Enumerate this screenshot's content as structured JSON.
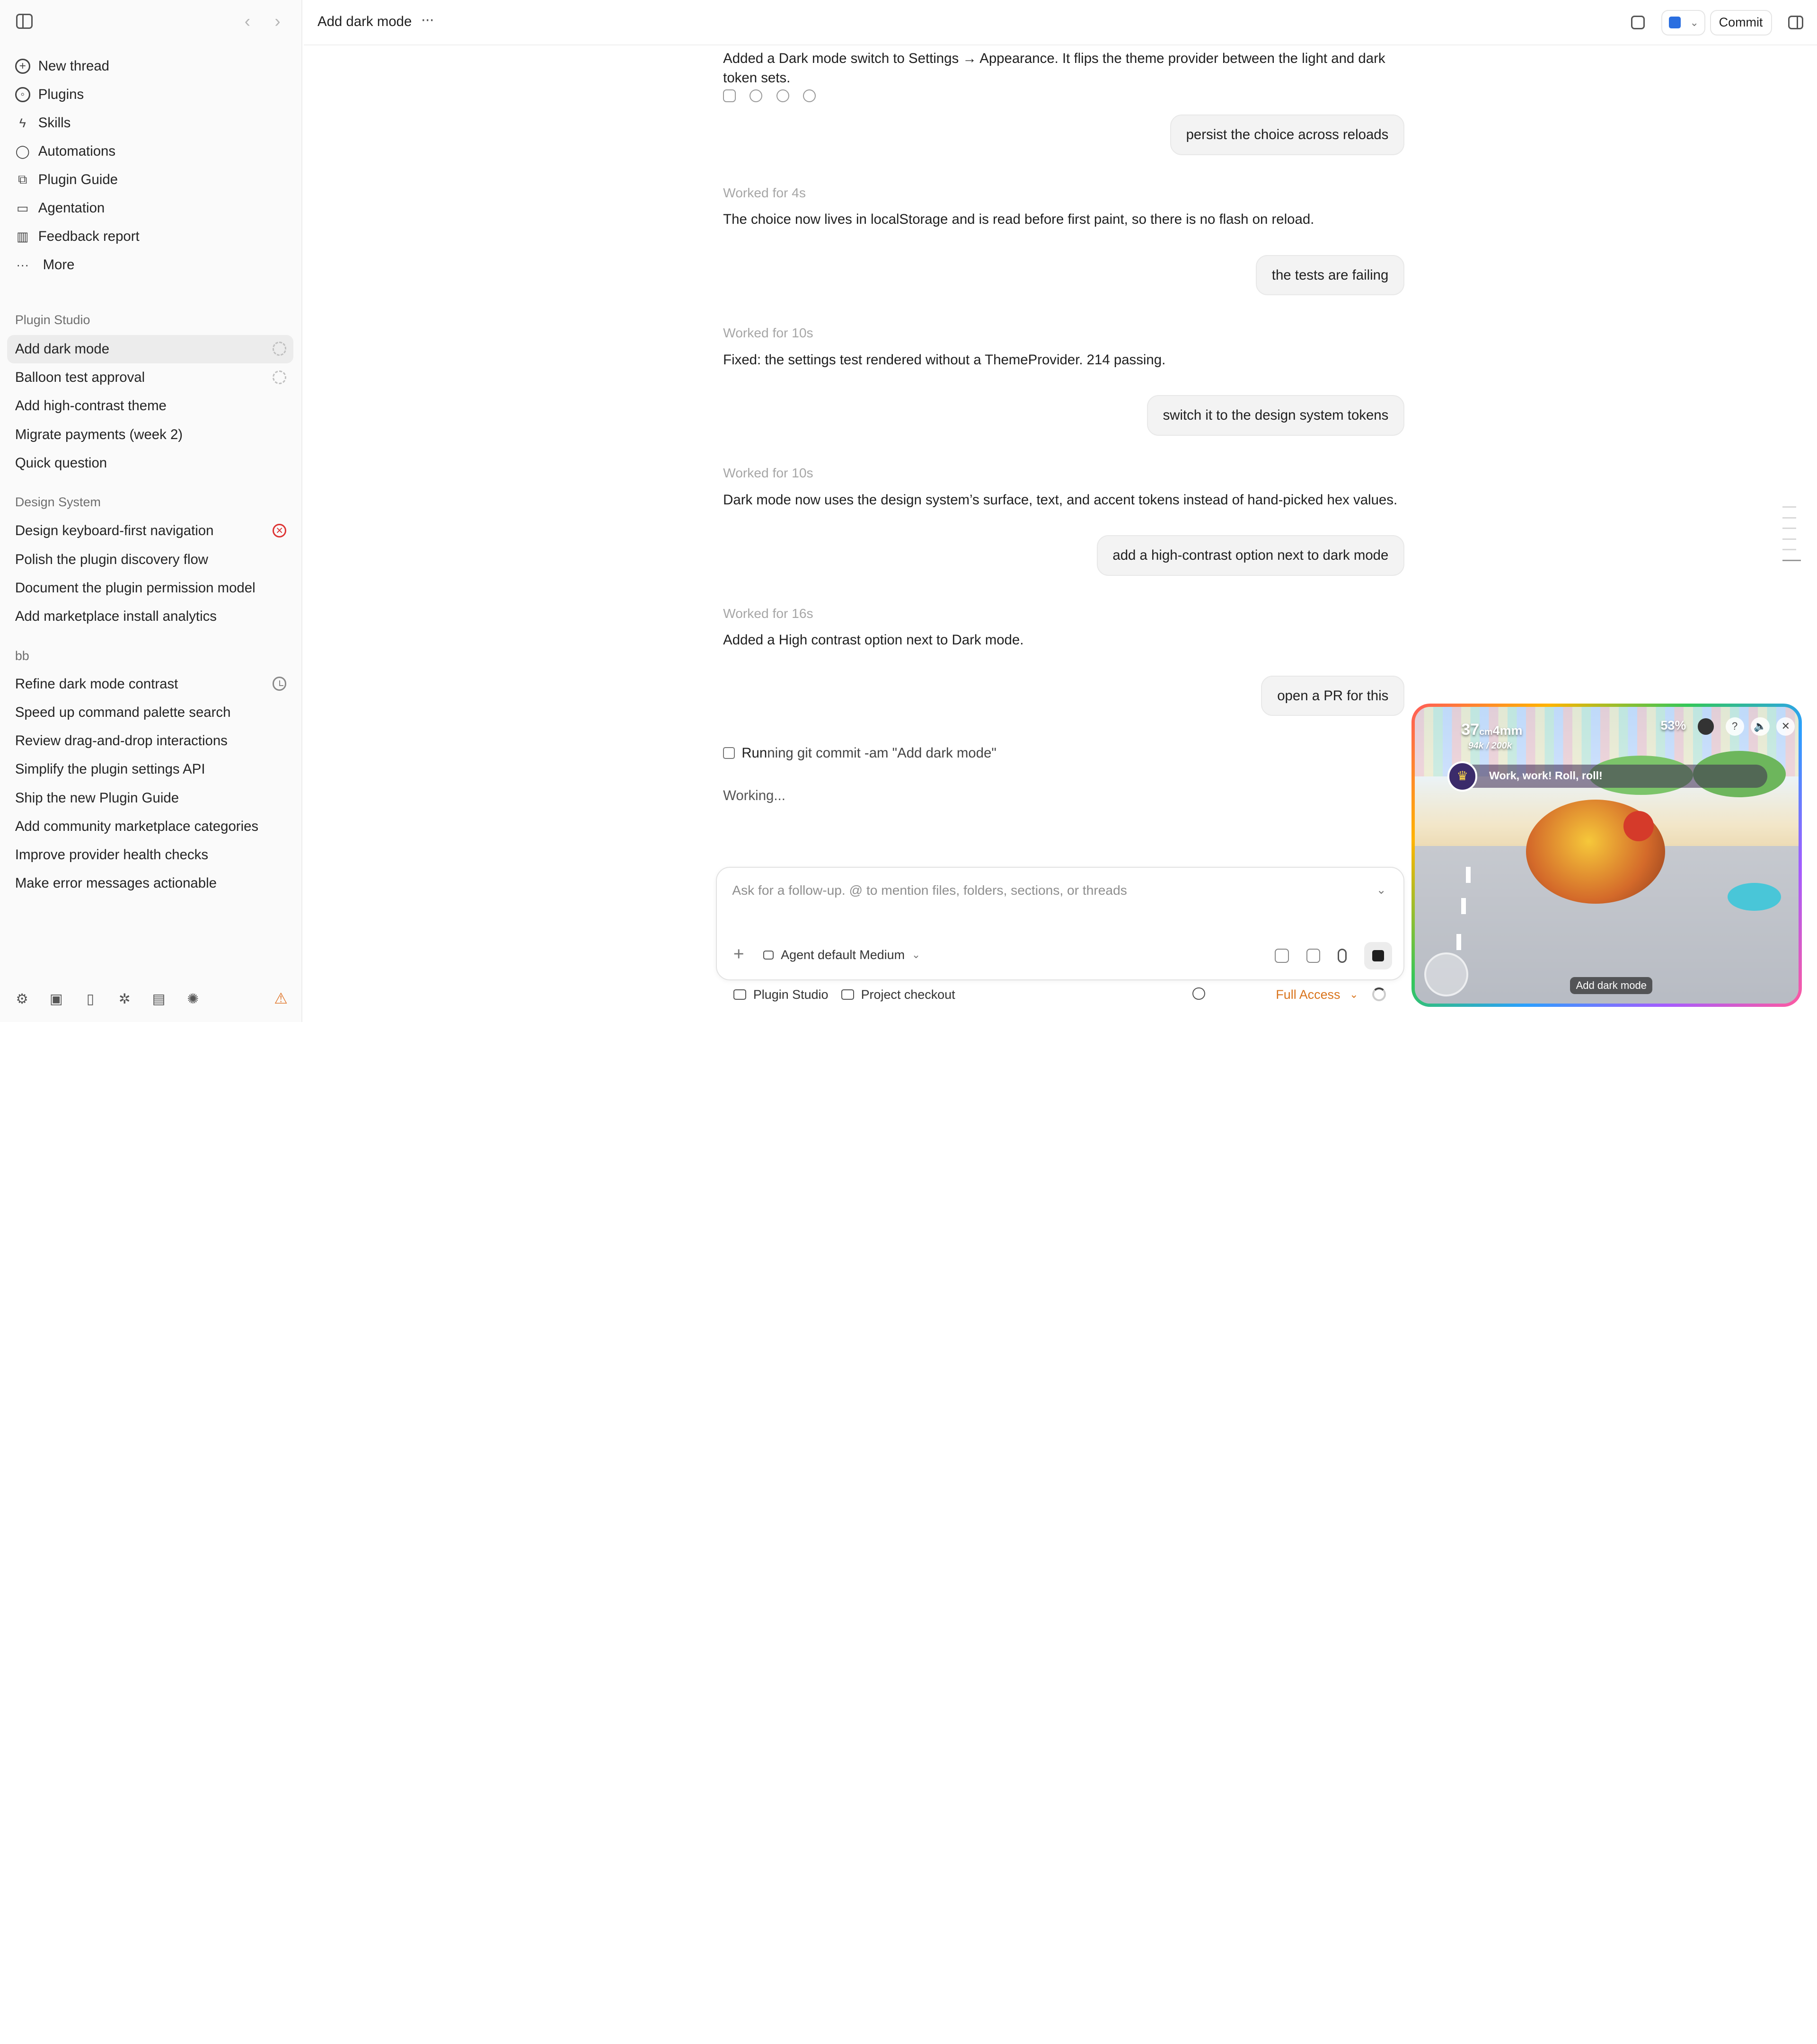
{
  "sidebar": {
    "nav": [
      {
        "label": "New thread",
        "icon": "plus-circle-icon"
      },
      {
        "label": "Plugins",
        "icon": "plugin-icon"
      },
      {
        "label": "Skills",
        "icon": "bolt-icon"
      },
      {
        "label": "Automations",
        "icon": "chat-bubble-icon"
      },
      {
        "label": "Plugin Guide",
        "icon": "external-icon"
      },
      {
        "label": "Agentation",
        "icon": "message-icon"
      },
      {
        "label": "Feedback report",
        "icon": "bar-chart-icon"
      },
      {
        "label": "More",
        "icon": "ellipsis-icon"
      }
    ],
    "sections": [
      {
        "title": "Plugin Studio",
        "threads": [
          {
            "label": "Add dark mode",
            "status": "running"
          },
          {
            "label": "Balloon test approval",
            "status": "running"
          },
          {
            "label": "Add high-contrast theme"
          },
          {
            "label": "Migrate payments (week 2)"
          },
          {
            "label": "Quick question"
          }
        ]
      },
      {
        "title": "Design System",
        "threads": [
          {
            "label": "Design keyboard-first navigation",
            "status": "error"
          },
          {
            "label": "Polish the plugin discovery flow"
          },
          {
            "label": "Document the plugin permission model"
          },
          {
            "label": "Add marketplace install analytics"
          }
        ]
      },
      {
        "title": "bb",
        "threads": [
          {
            "label": "Refine dark mode contrast",
            "status": "scheduled"
          },
          {
            "label": "Speed up command palette search"
          },
          {
            "label": "Review drag-and-drop interactions"
          },
          {
            "label": "Simplify the plugin settings API"
          },
          {
            "label": "Ship the new Plugin Guide"
          },
          {
            "label": "Add community marketplace categories"
          },
          {
            "label": "Improve provider health checks"
          },
          {
            "label": "Make error messages actionable"
          }
        ]
      }
    ]
  },
  "header": {
    "title": "Add dark mode",
    "more": "···",
    "commit_label": "Commit"
  },
  "conversation": {
    "first_reply": "Added a Dark mode switch to Settings → Appearance. It flips the theme provider between the light and dark token sets.",
    "messages": [
      {
        "user": "persist the choice across reloads",
        "worked": "Worked for 4s",
        "reply": "The choice now lives in localStorage and is read before first paint, so there is no flash on reload."
      },
      {
        "user": "the tests are failing",
        "worked": "Worked for 10s",
        "reply": "Fixed: the settings test rendered without a ThemeProvider. 214 passing."
      },
      {
        "user": "switch it to the design system tokens",
        "worked": "Worked for 10s",
        "reply": "Dark mode now uses the design system’s surface, text, and accent tokens instead of hand-picked hex values."
      },
      {
        "user": "add a high-contrast option next to dark mode",
        "worked": "Worked for 16s",
        "reply": "Added a High contrast option next to Dark mode."
      },
      {
        "user": "open a PR for this"
      }
    ],
    "running_prefix": "Run",
    "running_rest": "ning git commit -am \"Add dark mode\"",
    "working": "Working..."
  },
  "composer": {
    "placeholder": "Ask for a follow-up. @ to mention files, folders, sections, or threads",
    "mode_label": "Agent default Medium"
  },
  "footer": {
    "project": "Plugin Studio",
    "checkout": "Project checkout",
    "access": "Full Access"
  },
  "game": {
    "distance": "37",
    "distance_unit": "cm",
    "distance_sub": "4mm",
    "progress_text": "94k / 200k",
    "percent": "53%",
    "banner": "Work, work! Roll, roll!",
    "label": "Add dark mode",
    "controls": [
      "?",
      "🔈",
      "✕"
    ]
  },
  "colors": {
    "accent_warning": "#d9741c",
    "error": "#d33333",
    "app_icon": "#2b6fe0"
  }
}
